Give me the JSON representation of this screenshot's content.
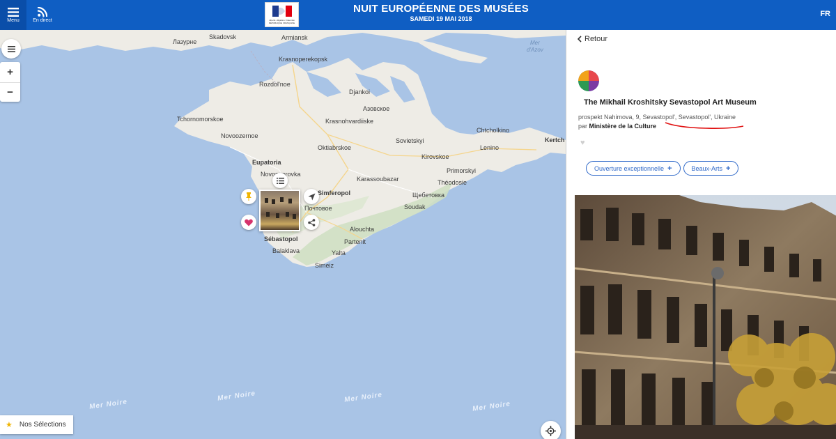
{
  "header": {
    "menu_label": "Menu",
    "live_label": "En direct",
    "logo_text": "Liberté • Égalité • Fraternité RÉPUBLIQUE FRANÇAISE",
    "title": "NUIT EUROPÉENNE DES MUSÉES",
    "date": "SAMEDI 19 MAI 2018",
    "language": "FR"
  },
  "map": {
    "places": [
      {
        "name": "Лазурне",
        "bold": false
      },
      {
        "name": "Skadovsk",
        "bold": false
      },
      {
        "name": "Armiansk",
        "bold": false
      },
      {
        "name": "Krasnoperekopsk",
        "bold": false
      },
      {
        "name": "Rozdol'noe",
        "bold": false
      },
      {
        "name": "Djankoi",
        "bold": false
      },
      {
        "name": "Азовское",
        "bold": false
      },
      {
        "name": "Tchornomorskoe",
        "bold": false
      },
      {
        "name": "Krasnohvardiiske",
        "bold": false
      },
      {
        "name": "Novoozernoe",
        "bold": false
      },
      {
        "name": "Sovietskyi",
        "bold": false
      },
      {
        "name": "Chtcholkino",
        "bold": false
      },
      {
        "name": "Oktiabrskoe",
        "bold": false
      },
      {
        "name": "Lenino",
        "bold": false
      },
      {
        "name": "Kertch",
        "bold": true
      },
      {
        "name": "Kirovskoe",
        "bold": false
      },
      {
        "name": "Eupatoria",
        "bold": true
      },
      {
        "name": "Novoozerovka",
        "bold": false
      },
      {
        "name": "Primorskyi",
        "bold": false
      },
      {
        "name": "Karassoubazar",
        "bold": false
      },
      {
        "name": "Théodosie",
        "bold": false
      },
      {
        "name": "Simferopol",
        "bold": true
      },
      {
        "name": "Щебетовка",
        "bold": false
      },
      {
        "name": "Почтовое",
        "bold": false
      },
      {
        "name": "Soudak",
        "bold": false
      },
      {
        "name": "Alouchta",
        "bold": false
      },
      {
        "name": "Sébastopol",
        "bold": true
      },
      {
        "name": "Partenit",
        "bold": false
      },
      {
        "name": "Balaklava",
        "bold": false
      },
      {
        "name": "Yalta",
        "bold": false
      },
      {
        "name": "Simeiz",
        "bold": false
      }
    ],
    "azov_label_1": "Mer",
    "azov_label_2": "d'Azov",
    "sea_label": "Mer Noire",
    "selections_label": "Nos Sélections"
  },
  "panel": {
    "back_label": "Retour",
    "museum_name": "The Mikhail Kroshitsky Sevastopol Art Museum",
    "address": "prospekt Nahimova, 9, Sevastopol', Sevastopol', Ukraine",
    "by_prefix": "par",
    "by_org": "Ministère de la Culture",
    "tags": [
      "Ouverture exceptionnelle",
      "Beaux-Arts"
    ]
  },
  "colors": {
    "header_blue": "#0f5ec3",
    "sea": "#a9c4e6",
    "land": "#eeece6",
    "tag_blue": "#2e68c8",
    "pin_red": "#d6336c",
    "pin_yellow": "#f0b400"
  }
}
